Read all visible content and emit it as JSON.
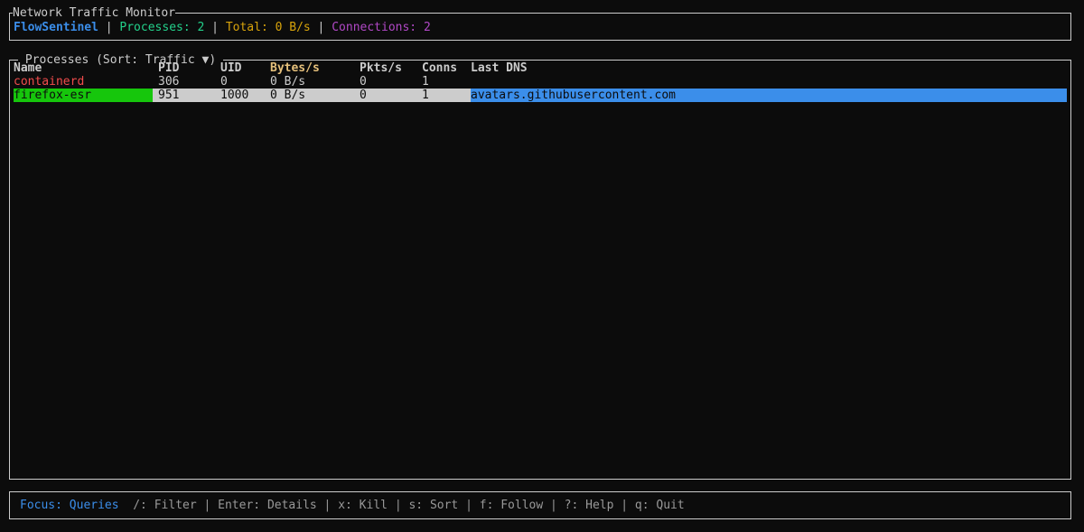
{
  "header": {
    "title": "Network Traffic Monitor",
    "brand": "FlowSentinel",
    "processes": "Processes: 2",
    "total": "Total: 0 B/s",
    "connections": "Connections: 2",
    "separator": " | "
  },
  "processes": {
    "title": " Processes (Sort: Traffic ▼) ",
    "columns": {
      "name": "Name",
      "pid": "PID",
      "uid": "UID",
      "bytes": "Bytes/s",
      "pkts": "Pkts/s",
      "conns": "Conns",
      "dns": "Last DNS"
    },
    "rows": [
      {
        "name": "containerd",
        "pid": "306",
        "uid": "0",
        "bytes": "0 B/s",
        "pkts": "0",
        "conns": "1",
        "dns": ""
      },
      {
        "name": "firefox-esr",
        "pid": "951",
        "uid": "1000",
        "bytes": "0 B/s",
        "pkts": "0",
        "conns": "1",
        "dns": "avatars.githubusercontent.com"
      }
    ]
  },
  "footer": {
    "focus": "Focus: Queries",
    "hints": "  /: Filter | Enter: Details | x: Kill | s: Sort | f: Follow | ?: Help | q: Quit"
  },
  "colors": {
    "brand": "#3b8eea",
    "processes": "#23d18b",
    "total": "#e5c07b",
    "connections": "#b148c6",
    "selected_name_bg": "#16c60c",
    "selected_dns_bg": "#3b8eea",
    "row_process_red": "#f14c4c"
  }
}
